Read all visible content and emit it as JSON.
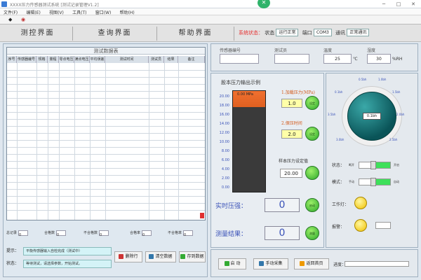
{
  "window": {
    "title": "XXXX压力传感器测试系统 [测试记录管理V1.2]",
    "min": "─",
    "max": "□",
    "close": "✕",
    "badge": "✕"
  },
  "menu": [
    "文件(F)",
    "编辑(E)",
    "视图(V)",
    "工具(T)",
    "窗口(W)",
    "帮助(H)"
  ],
  "toolbar": {
    "icon1": "◆",
    "icon2": "◉"
  },
  "tabs": [
    "测控界面",
    "查询界面",
    "帮助界面"
  ],
  "status": {
    "label": "系统状态：",
    "items": [
      {
        "label": "状态",
        "value": "运行正常"
      },
      {
        "label": "端口",
        "value": "COM3"
      },
      {
        "label": "通讯",
        "value": "正常通讯"
      }
    ]
  },
  "table": {
    "title": "测试数据表",
    "columns": [
      "序号",
      "传感器编号",
      "规格",
      "量程",
      "零点电压",
      "满点电压",
      "平均误差",
      "测试时间",
      "测试员",
      "结果",
      "备注"
    ]
  },
  "stats": [
    {
      "label": "总记录",
      "value": "0"
    },
    {
      "label": "合格数",
      "value": "0"
    },
    {
      "label": "不合格数",
      "value": "0"
    },
    {
      "label": "合格率",
      "value": "0"
    },
    {
      "label": "不合格率",
      "value": "0"
    }
  ],
  "info": {
    "hint_key": "提示：",
    "hint_val": "平衡传感器输入自检完成（测试中）",
    "result_key": "状态：",
    "result_val": "等待测试，请选择参数，开始测试。"
  },
  "left_buttons": {
    "delete": "删除行",
    "clear": "清空数据",
    "save": "存到数据"
  },
  "fields": {
    "sensor_no": {
      "label": "传感器编号",
      "value": ""
    },
    "tester": {
      "label": "测试员",
      "value": ""
    },
    "temp": {
      "label": "温度",
      "value": "25",
      "unit": "℃"
    },
    "humidity": {
      "label": "湿度",
      "value": "30",
      "unit": "%RH"
    }
  },
  "gauge": {
    "title": "股本压力输出示例",
    "scale": [
      "20.00",
      "18.00",
      "16.00",
      "14.00",
      "12.00",
      "10.00",
      "8.00",
      "6.00",
      "4.00",
      "2.00",
      "0.00"
    ],
    "level": 0.16,
    "fill_label": "0.00 MPa"
  },
  "controls": {
    "pressure_label": "1.加载压力(MPa)",
    "pressure_value": "1.0",
    "hold_label": "2.保压时间",
    "hold_value": "2.0",
    "threshold_label": "样本压力设定值",
    "threshold_value": "20.00",
    "btn1": "设定",
    "btn2": "设定",
    "realtime_label": "实时压强：",
    "realtime_value": "0",
    "result_label": "测量结果：",
    "result_value": "0",
    "btn_start": "启动",
    "btn_measure": "测量"
  },
  "knob": {
    "value": "0.1bh",
    "ticks": [
      "0.5bh",
      "1.0bh",
      "1.5bh",
      "2.0bh",
      "2.5bh",
      "3.0bh",
      "3.5bh",
      "0.1bh"
    ],
    "sw1_label": "状态：",
    "sw1_left": "断开",
    "sw1_right": "开启",
    "sw2_label": "模式：",
    "sw2_left": "手动",
    "sw2_right": "自动",
    "led1_label": "工作灯：",
    "led1_text": "",
    "led2_label": "报警：",
    "led2_text": ""
  },
  "bottom": {
    "start": "启 动",
    "manual": "手动采集",
    "back": "返回首页",
    "progress_label": "进度："
  }
}
